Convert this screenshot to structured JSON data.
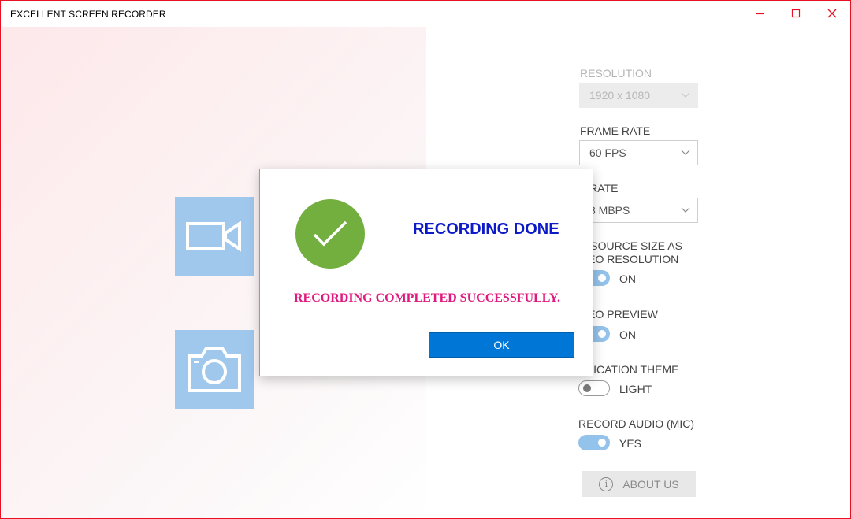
{
  "window": {
    "title": "EXCELLENT SCREEN RECORDER",
    "accent_color": "#e81123"
  },
  "tiles": {
    "video_icon": "video-camera-icon",
    "photo_icon": "camera-icon",
    "tile_color": "#9fc8ec"
  },
  "settings": {
    "resolution": {
      "label": "RESOLUTION",
      "value": "1920 x 1080",
      "disabled": true
    },
    "frame_rate": {
      "label": "FRAME RATE",
      "value": "60 FPS"
    },
    "bit_rate": {
      "label": "T RATE",
      "value": "8 MBPS"
    },
    "source_size": {
      "label_line1": "E SOURCE SIZE AS",
      "label_line2": "DEO RESOLUTION",
      "value": "ON",
      "state": "on"
    },
    "video_preview": {
      "label": "DEO PREVIEW",
      "value": "ON",
      "state": "on"
    },
    "app_theme": {
      "label": "PLICATION THEME",
      "value": "LIGHT",
      "state": "off"
    },
    "record_audio": {
      "label": "RECORD AUDIO (MIC)",
      "value": "YES",
      "state": "on"
    },
    "about_label": "ABOUT US"
  },
  "dialog": {
    "title": "RECORDING DONE",
    "message": "RECORDING COMPLETED SUCCESSFULLY.",
    "ok_label": "OK",
    "title_color": "#0d1ac8",
    "message_color": "#e0197e",
    "check_color": "#72af3e",
    "button_color": "#0077d6"
  }
}
